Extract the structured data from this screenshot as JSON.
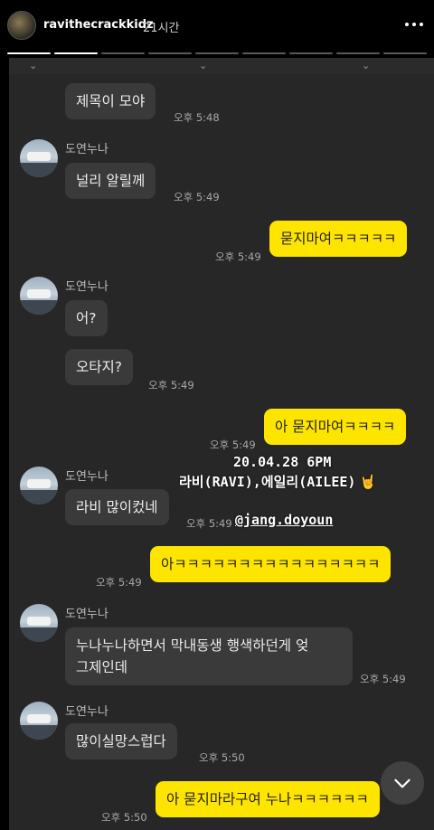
{
  "story": {
    "username": "ravithecrackkidz",
    "time_ago": "21시간",
    "progress": {
      "total": 9,
      "viewed": 2
    }
  },
  "overlay": {
    "date_line": "20.04.28 6PM",
    "names_line": "라비(RAVI),에일리(AILEE)",
    "emoji_icon": "rock-hand-icon",
    "mention": "@jang.doyoun"
  },
  "chat": {
    "partner_name": "도연누나",
    "messages": [
      {
        "text": "제목이 모야",
        "time": "오후 5:48"
      },
      {
        "sender": "도연누나",
        "text": "널리 알릴께",
        "time": "오후 5:49"
      },
      {
        "text": "묻지마여ㅋㅋㅋㅋㅋ",
        "time": "오후 5:49"
      },
      {
        "sender": "도연누나",
        "text": "어?"
      },
      {
        "text": "오타지?",
        "time": "오후 5:49"
      },
      {
        "text": "아 묻지마여ㅋㅋㅋㅋ",
        "time": "오후 5:49"
      },
      {
        "sender": "도연누나",
        "text": "라비 많이컸네",
        "time": "오후 5:49"
      },
      {
        "text": "아ㅋㅋㅋㅋㅋㅋㅋㅋㅋㅋㅋㅋㅋㅋㅋㅋ",
        "time": "오후 5:49"
      },
      {
        "sender": "도연누나",
        "text_line1": "누나누나하면서 막내동생 행색하던게 엊",
        "text_line2": "그제인데",
        "time": "오후 5:49"
      },
      {
        "sender": "도연누나",
        "text": "많이실망스럽다",
        "time": "오후 5:50"
      },
      {
        "text": "아 묻지마라구여 누나ㅋㅋㅋㅋㅋㅋ",
        "time": "오후 5:50"
      }
    ]
  },
  "colors": {
    "my_bubble": "#fee500",
    "their_bubble": "#3a3a3a",
    "chat_bg": "#272727"
  },
  "icons": {
    "more": "more-horizontal-icon",
    "scroll": "chevron-down-icon"
  }
}
